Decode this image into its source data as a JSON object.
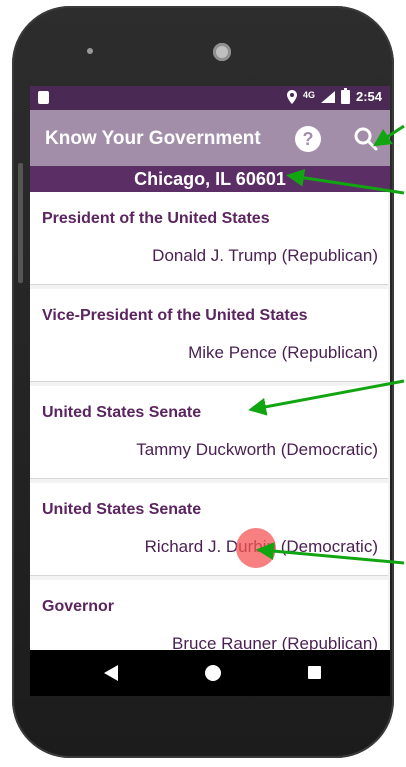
{
  "statusbar": {
    "time": "2:54",
    "network": "4G"
  },
  "appbar": {
    "title": "Know Your Government",
    "help_glyph": "?"
  },
  "location": {
    "label": "Chicago, IL 60601"
  },
  "officials": [
    {
      "office": "President of the United States",
      "name": "Donald J. Trump (Republican)"
    },
    {
      "office": "Vice-President of the United States",
      "name": "Mike Pence (Republican)"
    },
    {
      "office": "United States Senate",
      "name": "Tammy Duckworth (Democratic)"
    },
    {
      "office": "United States Senate",
      "name": "Richard J. Durbin (Democratic)"
    },
    {
      "office": "Governor",
      "name": "Bruce Rauner (Republican)"
    }
  ],
  "colors": {
    "statusbar": "#4a2a55",
    "appbar": "#a38ea9",
    "location_bar": "#5c2e66",
    "office_text": "#5b2560",
    "annotation_arrow": "#11a611",
    "tap_indicator": "#f55555"
  },
  "icons": [
    "sd-card-icon",
    "location-pin-icon",
    "signal-icon",
    "battery-icon",
    "help-icon",
    "search-icon",
    "back-icon",
    "home-icon",
    "recents-icon"
  ]
}
